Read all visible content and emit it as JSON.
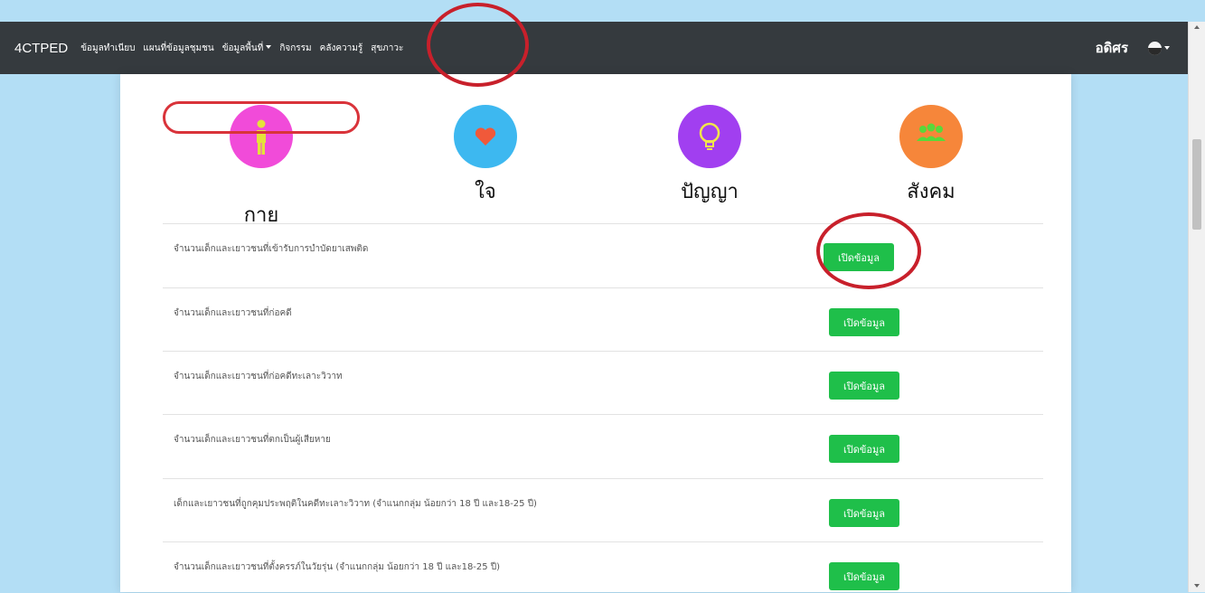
{
  "navbar": {
    "brand": "4CTPED",
    "items": [
      {
        "label": "ข้อมูลทำเนียบ",
        "dropdown": false
      },
      {
        "label": "แผนที่ข้อมูลชุมชน",
        "dropdown": false
      },
      {
        "label": "ข้อมูลพื้นที่",
        "dropdown": true
      },
      {
        "label": "กิจกรรม",
        "dropdown": false
      },
      {
        "label": "คลังความรู้",
        "dropdown": false
      },
      {
        "label": "สุขภาวะ",
        "dropdown": false
      }
    ],
    "username": "อดิศร"
  },
  "categories": [
    {
      "label": "กาย",
      "color": "#f14bd9",
      "icon": "person-icon"
    },
    {
      "label": "ใจ",
      "color": "#3db8f0",
      "icon": "heart-icon"
    },
    {
      "label": "ปัญญา",
      "color": "#a13ff0",
      "icon": "lightbulb-icon"
    },
    {
      "label": "สังคม",
      "color": "#f6863a",
      "icon": "people-icon"
    }
  ],
  "open_button_label": "เปิดข้อมูล",
  "rows": [
    {
      "text": "จำนวนเด็กและเยาวชนที่เข้ารับการบำบัดยาเสพติด"
    },
    {
      "text": "จำนวนเด็กและเยาวชนที่ก่อคดี"
    },
    {
      "text": "จำนวนเด็กและเยาวชนที่ก่อคดีทะเลาะวิวาท"
    },
    {
      "text": "จำนวนเด็กและเยาวชนที่ตกเป็นผู้เสียหาย"
    },
    {
      "text": "เด็กและเยาวชนที่ถูกคุมประพฤติในคดีทะเลาะวิวาท (จำแนกกลุ่ม น้อยกว่า 18 ปี และ18-25 ปี)"
    },
    {
      "text": "จำนวนเด็กและเยาวชนที่ตั้งครรภ์ในวัยรุ่น (จำแนกกลุ่ม น้อยกว่า 18 ปี และ18-25 ปี)"
    }
  ],
  "colors": {
    "navbar_bg": "#353a3e",
    "button_green": "#1fbf4a",
    "annotation_red": "#c8202b",
    "page_bg": "#b3def5"
  }
}
